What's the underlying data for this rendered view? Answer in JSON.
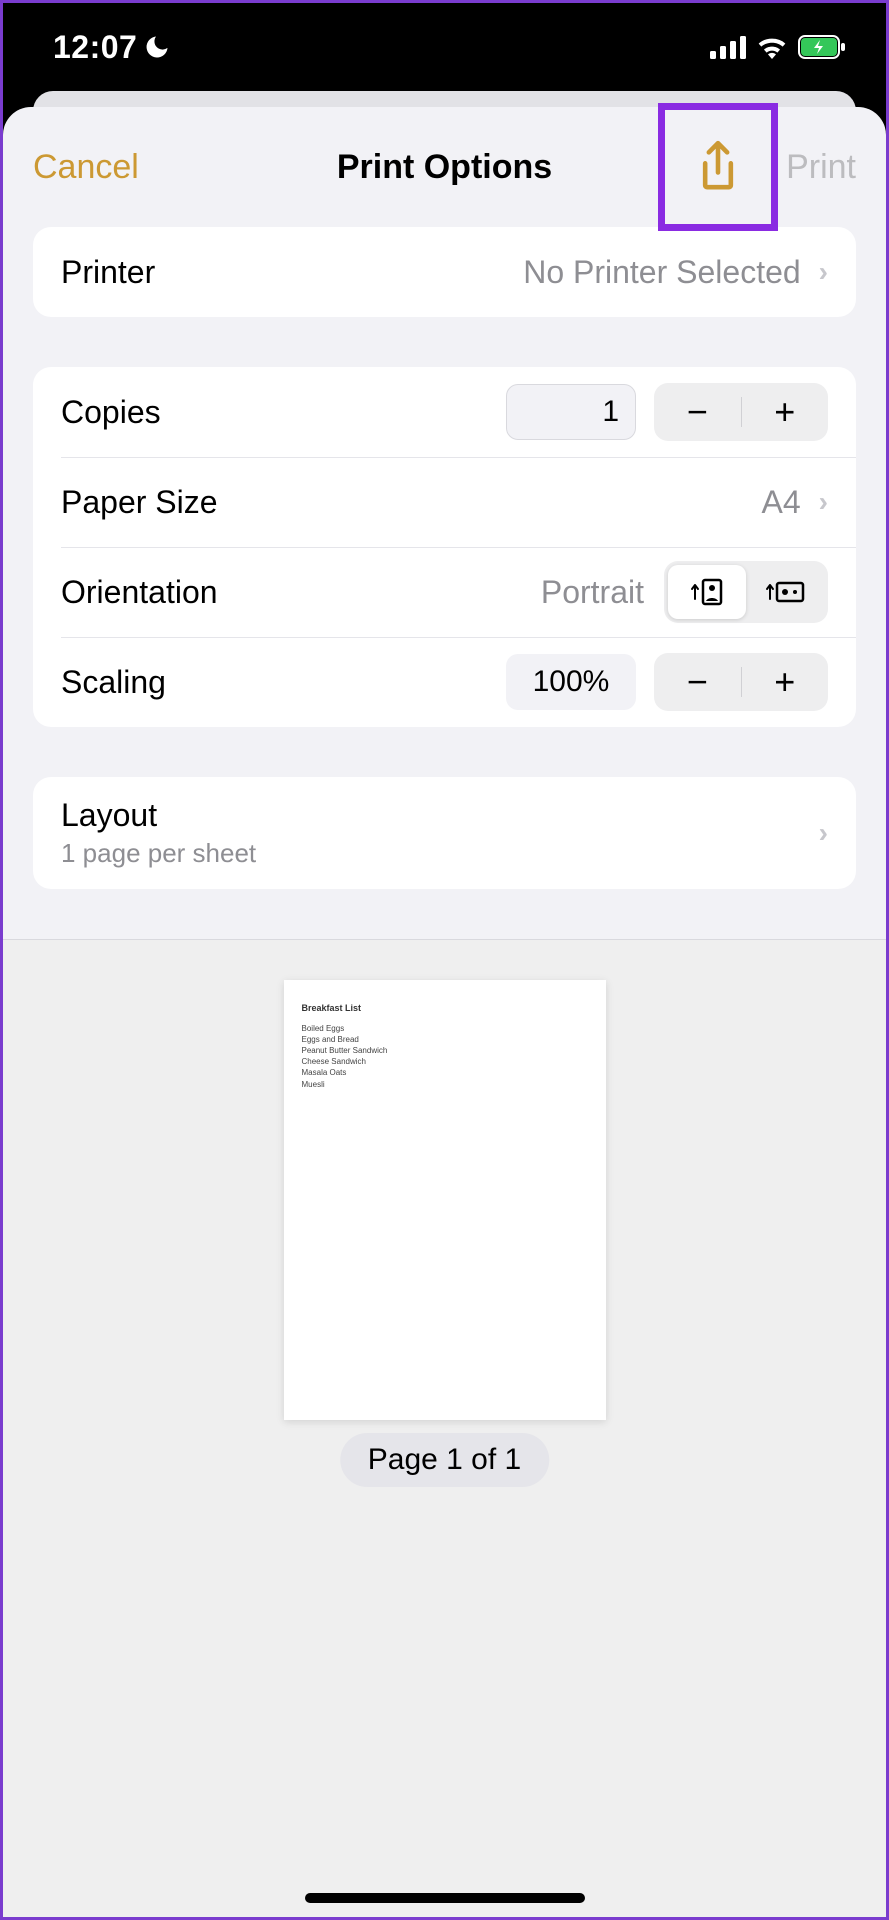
{
  "status": {
    "time": "12:07"
  },
  "nav": {
    "cancel": "Cancel",
    "title": "Print Options",
    "print": "Print"
  },
  "printer": {
    "label": "Printer",
    "value": "No Printer Selected"
  },
  "copies": {
    "label": "Copies",
    "value": "1"
  },
  "paperSize": {
    "label": "Paper Size",
    "value": "A4"
  },
  "orientation": {
    "label": "Orientation",
    "value": "Portrait"
  },
  "scaling": {
    "label": "Scaling",
    "value": "100%"
  },
  "layout": {
    "label": "Layout",
    "sub": "1 page per sheet"
  },
  "preview": {
    "title": "Breakfast List",
    "items": [
      "Boiled Eggs",
      "Eggs and Bread",
      "Peanut Butter Sandwich",
      "Cheese Sandwich",
      "Masala Oats",
      "Muesli"
    ],
    "pageIndicator": "Page 1 of 1"
  }
}
